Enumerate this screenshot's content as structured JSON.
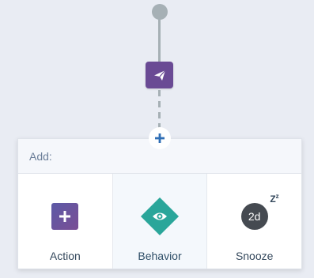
{
  "workflow": {
    "start_node": {
      "icon": "circle-node-icon"
    },
    "step_node": {
      "icon": "paper-plane-icon",
      "color": "#6a4a94"
    },
    "add_node": {
      "icon": "plus-icon",
      "color": "#2f6eb5"
    }
  },
  "add_panel": {
    "header": "Add:",
    "options": [
      {
        "label": "Action",
        "icon": "plus-square-icon",
        "color": "#6a4a94"
      },
      {
        "label": "Behavior",
        "icon": "eye-diamond-icon",
        "color": "#2aa69a"
      },
      {
        "label": "Snooze",
        "icon": "snooze-clock-icon",
        "badge": "2d",
        "zz": "Z",
        "zz_small": "z",
        "color": "#454a51"
      }
    ]
  }
}
